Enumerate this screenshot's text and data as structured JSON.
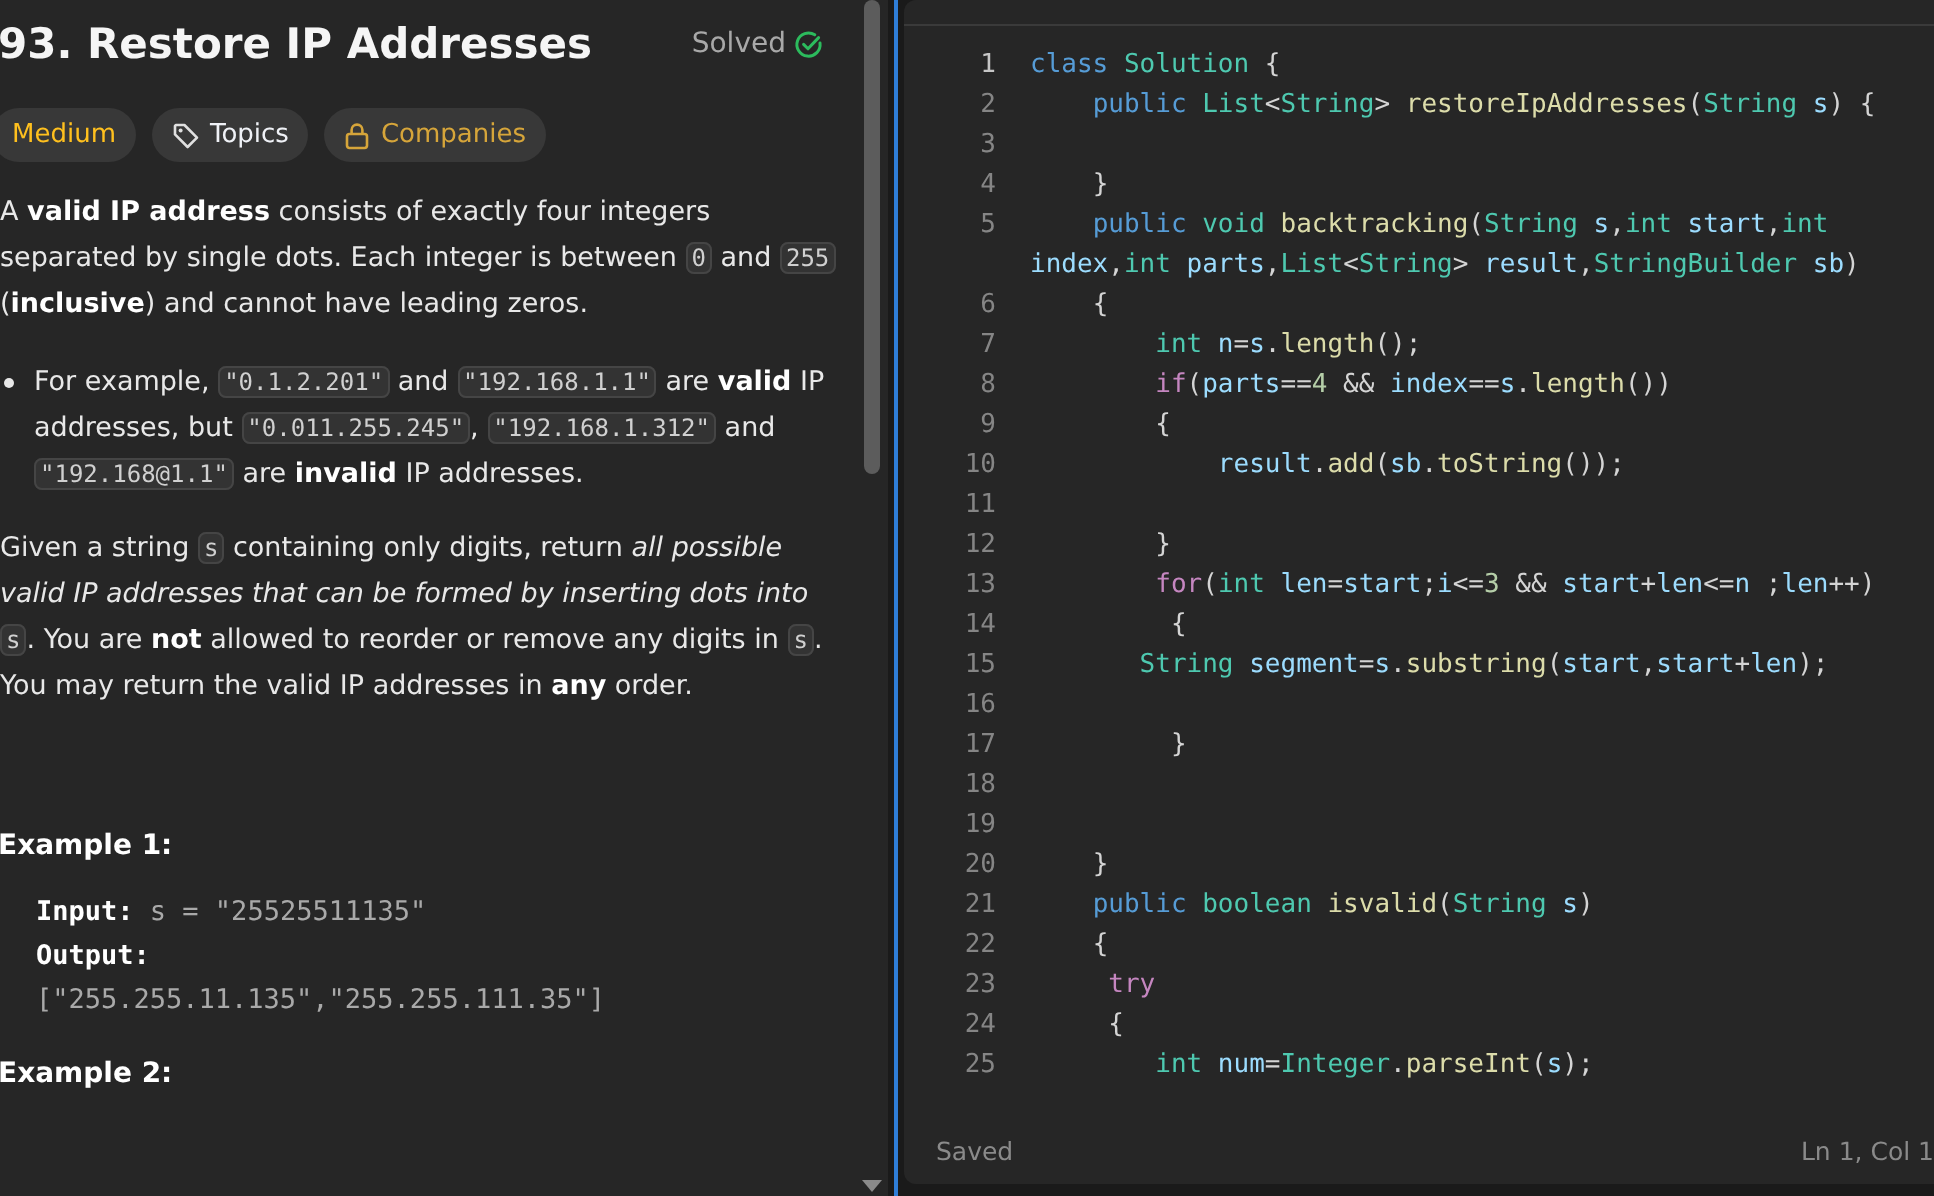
{
  "problem": {
    "title": "93. Restore IP Addresses",
    "status": "Solved",
    "tags": [
      {
        "kind": "difficulty",
        "label": "Medium"
      },
      {
        "kind": "topics",
        "label": "Topics"
      },
      {
        "kind": "companies",
        "label": "Companies"
      }
    ],
    "paragraphs": [
      {
        "kind": "text",
        "segments": [
          {
            "kind": "text",
            "text": "A **valid IP address** consists of exactly four integers separated by single dots. Each integer is between "
          },
          {
            "kind": "code",
            "text": "0"
          },
          {
            "kind": "text",
            "text": " and "
          },
          {
            "kind": "code",
            "text": "255"
          },
          {
            "kind": "text",
            "text": " (**inclusive**) and cannot have leading zeros."
          }
        ]
      },
      {
        "kind": "bullet",
        "segments": [
          {
            "kind": "text",
            "text": "For example, "
          },
          {
            "kind": "code",
            "text": "\"0.1.2.201\""
          },
          {
            "kind": "text",
            "text": " and "
          },
          {
            "kind": "code",
            "text": "\"192.168.1.1\""
          },
          {
            "kind": "text",
            "text": " are **valid** IP addresses, but "
          },
          {
            "kind": "code",
            "text": "\"0.011.255.245\""
          },
          {
            "kind": "text",
            "text": ", "
          },
          {
            "kind": "code",
            "text": "\"192.168.1.312\""
          },
          {
            "kind": "text",
            "text": " and "
          },
          {
            "kind": "code",
            "text": "\"192.168@1.1\""
          },
          {
            "kind": "text",
            "text": " are **invalid** IP addresses."
          }
        ]
      },
      {
        "kind": "text",
        "segments": [
          {
            "kind": "text",
            "text": "Given a string "
          },
          {
            "kind": "code",
            "text": "s"
          },
          {
            "kind": "text",
            "text": " containing only digits, return *all possible valid IP addresses that can be formed by inserting dots into* "
          },
          {
            "kind": "code",
            "text": "s"
          },
          {
            "kind": "text",
            "text": ". You are **not** allowed to reorder or remove any digits in "
          },
          {
            "kind": "code",
            "text": "s"
          },
          {
            "kind": "text",
            "text": ". You may return the valid IP addresses in **any** order."
          }
        ]
      }
    ],
    "examples": [
      {
        "heading": "Example 1:",
        "input_label": "Input:",
        "input": "s = \"25525511135\"",
        "output_label": "Output:",
        "output": "[\"255.255.11.135\",\"255.255.111.35\"]"
      },
      {
        "heading": "Example 2:"
      }
    ]
  },
  "editor": {
    "lines": [
      {
        "no": "1",
        "tokens": [
          {
            "kind": "keyword",
            "text": "class"
          },
          {
            "kind": "type",
            "text": " Solution"
          },
          {
            "kind": "plain",
            "text": " {"
          }
        ]
      },
      {
        "no": "2",
        "tokens": [
          {
            "kind": "keyword",
            "text": "    public"
          },
          {
            "kind": "type",
            "text": " List"
          },
          {
            "kind": "plain",
            "text": "<"
          },
          {
            "kind": "type",
            "text": "String"
          },
          {
            "kind": "plain",
            "text": ">"
          },
          {
            "kind": "function",
            "text": " restoreIpAddresses"
          },
          {
            "kind": "plain",
            "text": "("
          },
          {
            "kind": "type",
            "text": "String"
          },
          {
            "kind": "variable",
            "text": " s"
          },
          {
            "kind": "plain",
            "text": ") {"
          }
        ]
      },
      {
        "no": "3"
      },
      {
        "no": "4",
        "tokens": [
          {
            "kind": "plain",
            "text": "    }"
          }
        ]
      },
      {
        "no": "5",
        "tokens": [
          {
            "kind": "keyword",
            "text": "    public"
          },
          {
            "kind": "type",
            "text": " void"
          },
          {
            "kind": "function",
            "text": " backtracking"
          },
          {
            "kind": "plain",
            "text": "("
          },
          {
            "kind": "type",
            "text": "String"
          },
          {
            "kind": "variable",
            "text": " s"
          },
          {
            "kind": "plain",
            "text": ","
          },
          {
            "kind": "type",
            "text": "int"
          },
          {
            "kind": "variable",
            "text": " start"
          },
          {
            "kind": "plain",
            "text": ","
          },
          {
            "kind": "type",
            "text": "int"
          },
          {
            "kind": "variable",
            "text": " index"
          },
          {
            "kind": "plain",
            "text": ","
          },
          {
            "kind": "type",
            "text": "int"
          },
          {
            "kind": "variable",
            "text": " parts"
          },
          {
            "kind": "plain",
            "text": ","
          },
          {
            "kind": "type",
            "text": "List"
          },
          {
            "kind": "plain",
            "text": "<"
          },
          {
            "kind": "type",
            "text": "String"
          },
          {
            "kind": "plain",
            "text": ">"
          },
          {
            "kind": "variable",
            "text": " result"
          },
          {
            "kind": "plain",
            "text": ","
          },
          {
            "kind": "type",
            "text": "StringBuilder"
          },
          {
            "kind": "variable",
            "text": " sb"
          },
          {
            "kind": "plain",
            "text": ")"
          }
        ]
      },
      {
        "no": "6",
        "tokens": [
          {
            "kind": "plain",
            "text": "    {"
          }
        ]
      },
      {
        "no": "7",
        "tokens": [
          {
            "kind": "type",
            "text": "        int"
          },
          {
            "kind": "variable",
            "text": " n"
          },
          {
            "kind": "plain",
            "text": "="
          },
          {
            "kind": "variable",
            "text": "s"
          },
          {
            "kind": "plain",
            "text": "."
          },
          {
            "kind": "function",
            "text": "length"
          },
          {
            "kind": "plain",
            "text": "();"
          }
        ]
      },
      {
        "no": "8",
        "tokens": [
          {
            "kind": "control",
            "text": "        if"
          },
          {
            "kind": "plain",
            "text": "("
          },
          {
            "kind": "variable",
            "text": "parts"
          },
          {
            "kind": "plain",
            "text": "=="
          },
          {
            "kind": "number",
            "text": "4"
          },
          {
            "kind": "plain",
            "text": " &&"
          },
          {
            "kind": "variable",
            "text": " index"
          },
          {
            "kind": "plain",
            "text": "=="
          },
          {
            "kind": "variable",
            "text": "s"
          },
          {
            "kind": "plain",
            "text": "."
          },
          {
            "kind": "function",
            "text": "length"
          },
          {
            "kind": "plain",
            "text": "())"
          }
        ]
      },
      {
        "no": "9",
        "tokens": [
          {
            "kind": "plain",
            "text": "        {"
          }
        ]
      },
      {
        "no": "10",
        "tokens": [
          {
            "kind": "variable",
            "text": "            result"
          },
          {
            "kind": "plain",
            "text": "."
          },
          {
            "kind": "function",
            "text": "add"
          },
          {
            "kind": "plain",
            "text": "("
          },
          {
            "kind": "variable",
            "text": "sb"
          },
          {
            "kind": "plain",
            "text": "."
          },
          {
            "kind": "function",
            "text": "toString"
          },
          {
            "kind": "plain",
            "text": "());"
          }
        ]
      },
      {
        "no": "11"
      },
      {
        "no": "12",
        "tokens": [
          {
            "kind": "plain",
            "text": "        }"
          }
        ]
      },
      {
        "no": "13",
        "tokens": [
          {
            "kind": "control",
            "text": "        for"
          },
          {
            "kind": "plain",
            "text": "("
          },
          {
            "kind": "type",
            "text": "int"
          },
          {
            "kind": "variable",
            "text": " len"
          },
          {
            "kind": "plain",
            "text": "="
          },
          {
            "kind": "variable",
            "text": "start"
          },
          {
            "kind": "plain",
            "text": ";"
          },
          {
            "kind": "variable",
            "text": "i"
          },
          {
            "kind": "plain",
            "text": "<="
          },
          {
            "kind": "number",
            "text": "3"
          },
          {
            "kind": "plain",
            "text": " &&"
          },
          {
            "kind": "variable",
            "text": " start"
          },
          {
            "kind": "plain",
            "text": "+"
          },
          {
            "kind": "variable",
            "text": "len"
          },
          {
            "kind": "plain",
            "text": "<="
          },
          {
            "kind": "variable",
            "text": "n"
          },
          {
            "kind": "plain",
            "text": " ;"
          },
          {
            "kind": "variable",
            "text": "len"
          },
          {
            "kind": "plain",
            "text": "++)"
          }
        ]
      },
      {
        "no": "14",
        "tokens": [
          {
            "kind": "plain",
            "text": "         {"
          }
        ]
      },
      {
        "no": "15",
        "tokens": [
          {
            "kind": "type",
            "text": "       String"
          },
          {
            "kind": "variable",
            "text": " segment"
          },
          {
            "kind": "plain",
            "text": "="
          },
          {
            "kind": "variable",
            "text": "s"
          },
          {
            "kind": "plain",
            "text": "."
          },
          {
            "kind": "function",
            "text": "substring"
          },
          {
            "kind": "plain",
            "text": "("
          },
          {
            "kind": "variable",
            "text": "start"
          },
          {
            "kind": "plain",
            "text": ","
          },
          {
            "kind": "variable",
            "text": "start"
          },
          {
            "kind": "plain",
            "text": "+"
          },
          {
            "kind": "variable",
            "text": "len"
          },
          {
            "kind": "plain",
            "text": ");"
          }
        ]
      },
      {
        "no": "16"
      },
      {
        "no": "17",
        "tokens": [
          {
            "kind": "plain",
            "text": "         }"
          }
        ]
      },
      {
        "no": "18"
      },
      {
        "no": "19"
      },
      {
        "no": "20",
        "tokens": [
          {
            "kind": "plain",
            "text": "    }"
          }
        ]
      },
      {
        "no": "21",
        "tokens": [
          {
            "kind": "keyword",
            "text": "    public"
          },
          {
            "kind": "type",
            "text": " boolean"
          },
          {
            "kind": "function",
            "text": " isvalid"
          },
          {
            "kind": "plain",
            "text": "("
          },
          {
            "kind": "type",
            "text": "String"
          },
          {
            "kind": "variable",
            "text": " s"
          },
          {
            "kind": "plain",
            "text": ")"
          }
        ]
      },
      {
        "no": "22",
        "tokens": [
          {
            "kind": "plain",
            "text": "    {"
          }
        ]
      },
      {
        "no": "23",
        "tokens": [
          {
            "kind": "control",
            "text": "     try"
          }
        ]
      },
      {
        "no": "24",
        "tokens": [
          {
            "kind": "plain",
            "text": "     {"
          }
        ]
      },
      {
        "no": "25",
        "tokens": [
          {
            "kind": "type",
            "text": "        int"
          },
          {
            "kind": "variable",
            "text": " num"
          },
          {
            "kind": "plain",
            "text": "="
          },
          {
            "kind": "type",
            "text": "Integer"
          },
          {
            "kind": "plain",
            "text": "."
          },
          {
            "kind": "function",
            "text": "parseInt"
          },
          {
            "kind": "plain",
            "text": "("
          },
          {
            "kind": "variable",
            "text": "s"
          },
          {
            "kind": "plain",
            "text": ");"
          }
        ]
      }
    ],
    "status": "Saved",
    "cursor": "Ln 1, Col 1"
  }
}
